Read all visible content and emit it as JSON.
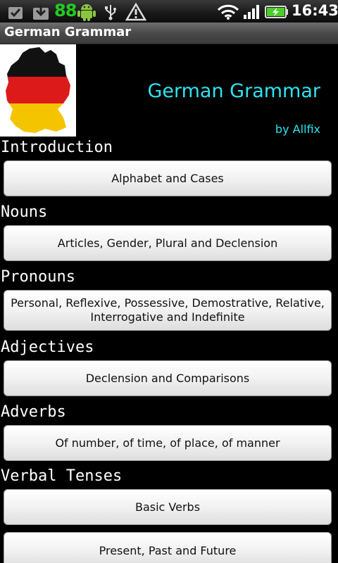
{
  "status_bar": {
    "battery_percent": "88",
    "time": "16:43",
    "icons": [
      "check-icon",
      "download-icon",
      "android-icon",
      "usb-icon",
      "warning-icon",
      "wifi-icon",
      "signal-icon",
      "battery-icon"
    ]
  },
  "window": {
    "title": "German Grammar"
  },
  "header": {
    "app_title": "German Grammar",
    "author": "by Allfix",
    "logo_icon": "germany-flag-map-icon",
    "title_color": "#2ee4f0"
  },
  "sections": [
    {
      "label": "Introduction",
      "button": "Alphabet and Cases"
    },
    {
      "label": "Nouns",
      "button": "Articles, Gender, Plural and Declension"
    },
    {
      "label": "Pronouns",
      "button": "Personal, Reflexive, Possessive, Demostrative, Relative, Interrogative and Indefinite"
    },
    {
      "label": "Adjectives",
      "button": "Declension and Comparisons"
    },
    {
      "label": "Adverbs",
      "button": "Of number, of time, of place, of manner"
    },
    {
      "label": "Verbal Tenses",
      "button": "Basic Verbs"
    },
    {
      "label": "",
      "button": "Present, Past and Future"
    }
  ]
}
